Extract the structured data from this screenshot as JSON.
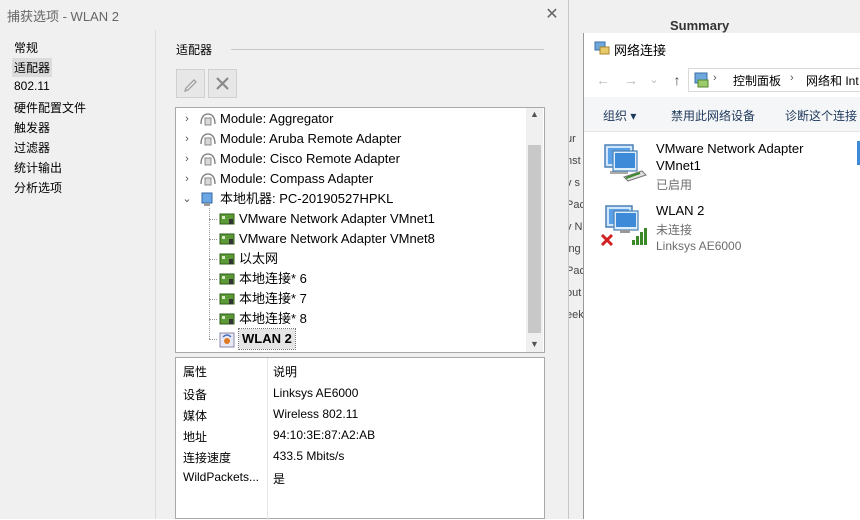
{
  "dialog": {
    "title": "捕获选项 - WLAN 2",
    "close_glyph": "✕",
    "nav": [
      "常规",
      "适配器",
      "802.11",
      "硬件配置文件",
      "触发器",
      "过滤器",
      "统计输出",
      "分析选项"
    ],
    "nav_selected": 1,
    "section_title": "适配器",
    "tree": [
      {
        "label": "Module: Aggregator",
        "kind": "module",
        "expander": "›"
      },
      {
        "label": "Module: Aruba Remote Adapter",
        "kind": "module",
        "expander": "›"
      },
      {
        "label": "Module: Cisco Remote Adapter",
        "kind": "module",
        "expander": "›"
      },
      {
        "label": "Module: Compass Adapter",
        "kind": "module",
        "expander": "›"
      },
      {
        "label": "本地机器: PC-20190527HPKL",
        "kind": "computer",
        "expander": "⌄"
      },
      {
        "label": "VMware Network Adapter VMnet1",
        "kind": "nic"
      },
      {
        "label": "VMware Network Adapter VMnet8",
        "kind": "nic"
      },
      {
        "label": "以太网",
        "kind": "nic"
      },
      {
        "label": "本地连接* 6",
        "kind": "nic"
      },
      {
        "label": "本地连接* 7",
        "kind": "nic"
      },
      {
        "label": "本地连接* 8",
        "kind": "nic"
      },
      {
        "label": "WLAN 2",
        "kind": "wlan",
        "selected": true
      }
    ],
    "properties": {
      "header": {
        "key": "属性",
        "value": "说明"
      },
      "rows": [
        {
          "key": "设备",
          "value": "Linksys AE6000"
        },
        {
          "key": "媒体",
          "value": "Wireless 802.11"
        },
        {
          "key": "地址",
          "value": "94:10:3E:87:A2:AB"
        },
        {
          "key": "连接速度",
          "value": "433.5 Mbits/s"
        },
        {
          "key": "WildPackets...",
          "value": "是"
        }
      ]
    }
  },
  "background_window": {
    "title": "Summary",
    "fragments": [
      "ur",
      "nst",
      "v s",
      "Pac",
      "v N",
      "ing",
      "Pac",
      "out",
      "eek"
    ]
  },
  "network_window": {
    "title": "网络连接",
    "breadcrumb": [
      "控制面板",
      "网络和 Int"
    ],
    "nav_glyphs": {
      "back": "←",
      "forward": "→",
      "dropdown": "⌄",
      "up": "↑",
      "sep": "›"
    },
    "commands": [
      "组织 ▾",
      "禁用此网络设备",
      "诊断这个连接"
    ],
    "connections": [
      {
        "name": "VMware Network Adapter",
        "name2": "VMnet1",
        "status": "已启用",
        "device": ""
      },
      {
        "name": "WLAN 2",
        "name2": "",
        "status": "未连接",
        "device": "Linksys AE6000"
      }
    ]
  },
  "colors": {
    "accent": "#0078d7",
    "nic_green": "#3a8a2a",
    "error_red": "#d21f1f"
  }
}
